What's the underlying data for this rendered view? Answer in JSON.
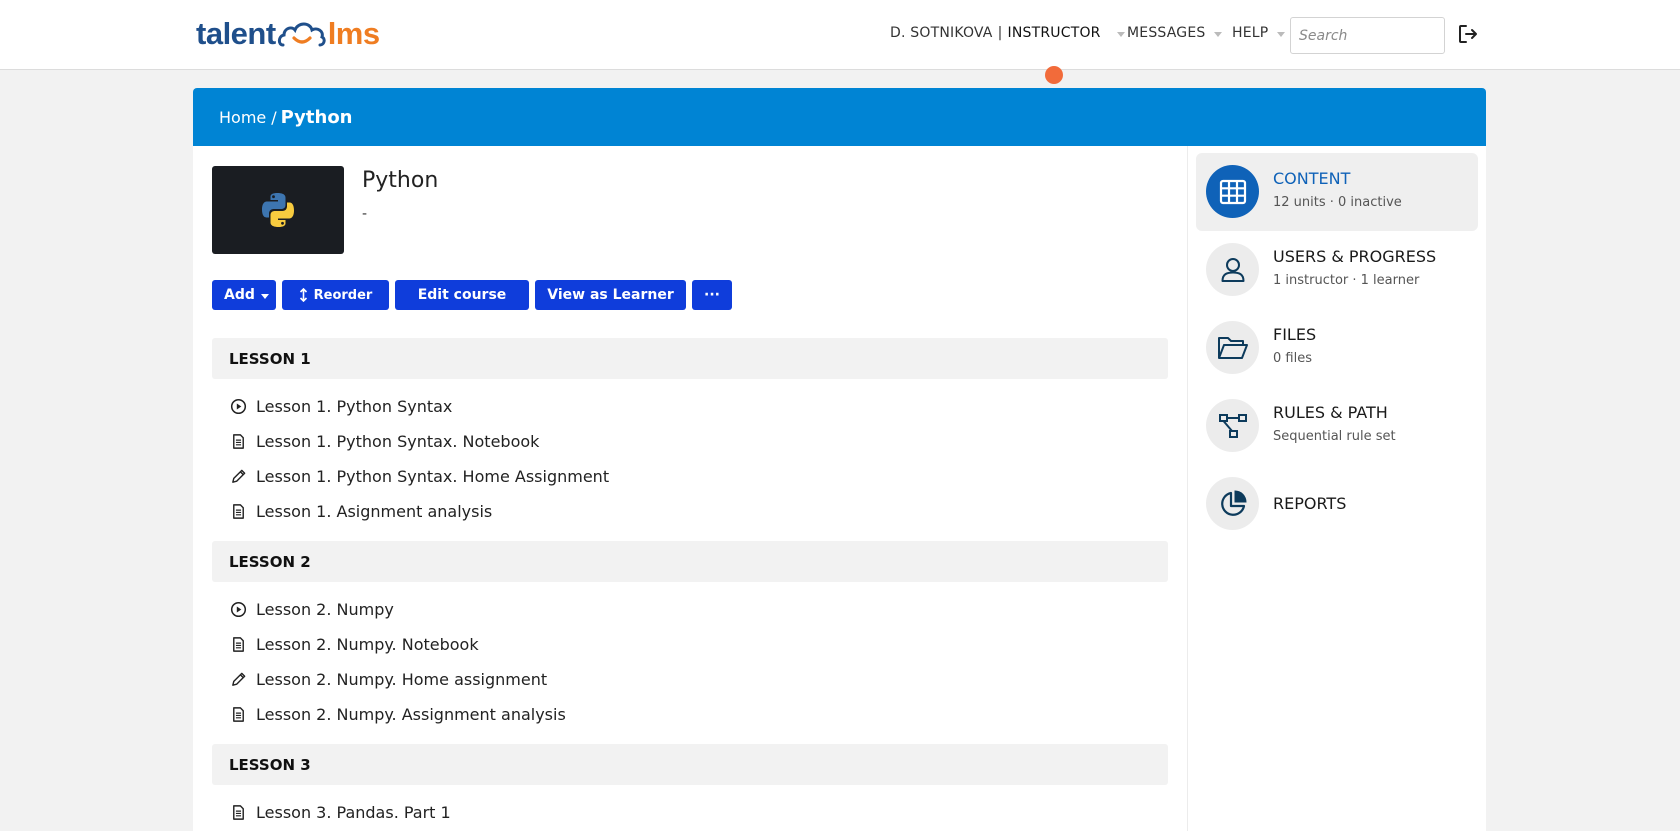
{
  "header": {
    "logo": {
      "part1": "talent",
      "part2": "lms"
    },
    "user": {
      "name": "D. SOTNIKOVA",
      "separator": "|",
      "role": "INSTRUCTOR"
    },
    "messages_label": "MESSAGES",
    "help_label": "HELP",
    "search_placeholder": "Search"
  },
  "breadcrumb": {
    "home": "Home",
    "separator": "/",
    "current": "Python"
  },
  "course": {
    "title": "Python",
    "description": "-"
  },
  "actions": {
    "add": "Add",
    "reorder": "Reorder",
    "edit": "Edit course",
    "view_as_learner": "View as Learner",
    "more": "···"
  },
  "sections": [
    {
      "title": "LESSON 1",
      "units": [
        {
          "label": "Lesson 1. Python Syntax",
          "icon": "play-icon"
        },
        {
          "label": "Lesson 1. Python Syntax. Notebook",
          "icon": "document-icon"
        },
        {
          "label": "Lesson 1. Python Syntax. Home Assignment",
          "icon": "pencil-icon"
        },
        {
          "label": "Lesson 1. Asignment analysis",
          "icon": "document-icon"
        }
      ]
    },
    {
      "title": "LESSON 2",
      "units": [
        {
          "label": "Lesson 2. Numpy",
          "icon": "play-icon"
        },
        {
          "label": "Lesson 2. Numpy. Notebook",
          "icon": "document-icon"
        },
        {
          "label": "Lesson 2. Numpy. Home assignment",
          "icon": "pencil-icon"
        },
        {
          "label": "Lesson 2. Numpy. Assignment analysis",
          "icon": "document-icon"
        }
      ]
    },
    {
      "title": "LESSON 3",
      "units": [
        {
          "label": "Lesson 3. Pandas. Part 1",
          "icon": "document-icon"
        }
      ]
    }
  ],
  "sidebar": {
    "items": [
      {
        "title": "CONTENT",
        "subtitle": "12 units · 0 inactive",
        "icon": "grid-icon",
        "active": true
      },
      {
        "title": "USERS & PROGRESS",
        "subtitle": "1 instructor · 1 learner",
        "icon": "user-icon"
      },
      {
        "title": "FILES",
        "subtitle": "0 files",
        "icon": "folder-icon"
      },
      {
        "title": "RULES & PATH",
        "subtitle": "Sequential rule set",
        "icon": "flow-icon"
      },
      {
        "title": "REPORTS",
        "icon": "pie-chart-icon"
      }
    ]
  },
  "colors": {
    "brand_blue": "#0084d4",
    "button_blue": "#0f3ddb",
    "active_blue": "#0f62b8",
    "logo_orange": "#ef7d22",
    "notification": "#f26b3a"
  }
}
